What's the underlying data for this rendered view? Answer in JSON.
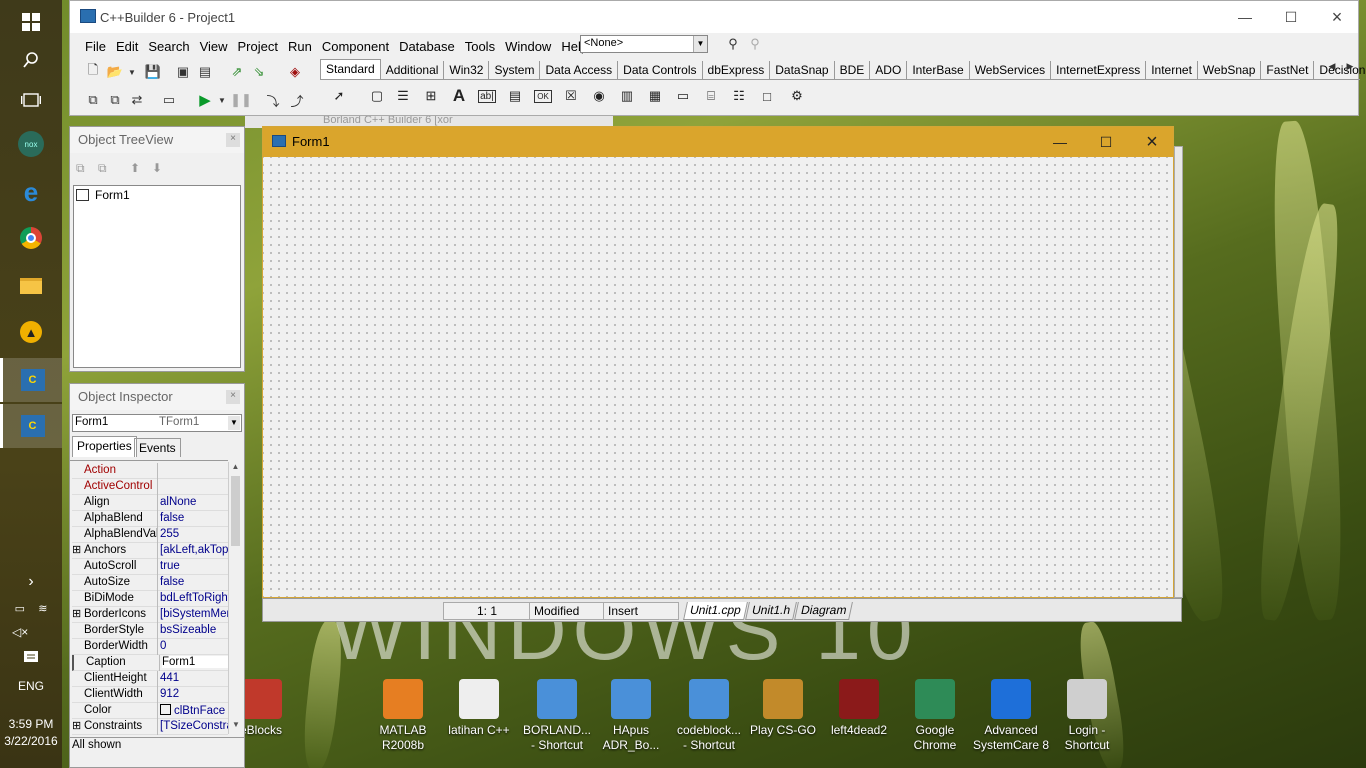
{
  "ide": {
    "title": "C++Builder 6 - Project1",
    "menu": [
      "File",
      "Edit",
      "Search",
      "View",
      "Project",
      "Run",
      "Component",
      "Database",
      "Tools",
      "Window",
      "Help"
    ],
    "combo_value": "<None>",
    "palette_tabs": [
      "Standard",
      "Additional",
      "Win32",
      "System",
      "Data Access",
      "Data Controls",
      "dbExpress",
      "DataSnap",
      "BDE",
      "ADO",
      "InterBase",
      "WebServices",
      "InternetExpress",
      "Internet",
      "WebSnap",
      "FastNet",
      "Decision Cube"
    ],
    "selected_tab": "Standard"
  },
  "background_window": {
    "title": "Borland C++ Builder 6 [xor"
  },
  "treeview": {
    "title": "Object TreeView",
    "node": "Form1"
  },
  "inspector": {
    "title": "Object Inspector",
    "object_name": "Form1",
    "object_type": "TForm1",
    "tabs": [
      "Properties",
      "Events"
    ],
    "rows": [
      {
        "name": "Action",
        "value": "",
        "red": true
      },
      {
        "name": "ActiveControl",
        "value": "",
        "red": true
      },
      {
        "name": "Align",
        "value": "alNone"
      },
      {
        "name": "AlphaBlend",
        "value": "false"
      },
      {
        "name": "AlphaBlendVal",
        "value": "255"
      },
      {
        "name": "Anchors",
        "value": "[akLeft,akTop",
        "plus": true
      },
      {
        "name": "AutoScroll",
        "value": "true"
      },
      {
        "name": "AutoSize",
        "value": "false"
      },
      {
        "name": "BiDiMode",
        "value": "bdLeftToRight"
      },
      {
        "name": "BorderIcons",
        "value": "[biSystemMen",
        "plus": true
      },
      {
        "name": "BorderStyle",
        "value": "bsSizeable"
      },
      {
        "name": "BorderWidth",
        "value": "0"
      },
      {
        "name": "Caption",
        "value": "Form1",
        "selected": true
      },
      {
        "name": "ClientHeight",
        "value": "441"
      },
      {
        "name": "ClientWidth",
        "value": "912"
      },
      {
        "name": "Color",
        "value": "clBtnFace",
        "swatch": true
      },
      {
        "name": "Constraints",
        "value": "[TSizeConstra",
        "plus": true
      }
    ],
    "status": "All shown"
  },
  "form": {
    "title": "Form1"
  },
  "editor": {
    "position": "1:  1",
    "modified": "Modified",
    "mode": "Insert",
    "tabs": [
      "Unit1.cpp",
      "Unit1.h",
      "Diagram"
    ]
  },
  "taskbar": {
    "time": "3:59 PM",
    "date": "3/22/2016",
    "lang": "ENG"
  },
  "desktop_icons": [
    {
      "label1": "eBlocks",
      "label2": "",
      "color": "#c0392b"
    },
    {
      "label1": "MATLAB",
      "label2": "R2008b",
      "color": "#e67e22"
    },
    {
      "label1": "latihan C++",
      "label2": "",
      "color": "#eeeeee"
    },
    {
      "label1": "BORLAND...",
      "label2": "- Shortcut",
      "color": "#4a90d9"
    },
    {
      "label1": "HApus",
      "label2": "ADR_Bo...",
      "color": "#4a90d9"
    },
    {
      "label1": "codeblock...",
      "label2": "- Shortcut",
      "color": "#4a90d9"
    },
    {
      "label1": "Play CS-GO",
      "label2": "",
      "color": "#c28a2a"
    },
    {
      "label1": "left4dead2",
      "label2": "",
      "color": "#8b1a1a"
    },
    {
      "label1": "Google",
      "label2": "Chrome",
      "color": "#2e8b57"
    },
    {
      "label1": "Advanced",
      "label2": "SystemCare 8",
      "color": "#1e6fd9"
    },
    {
      "label1": "Login -",
      "label2": "Shortcut",
      "color": "#cfcfcf"
    }
  ],
  "watermark": "WINDOWS 10"
}
